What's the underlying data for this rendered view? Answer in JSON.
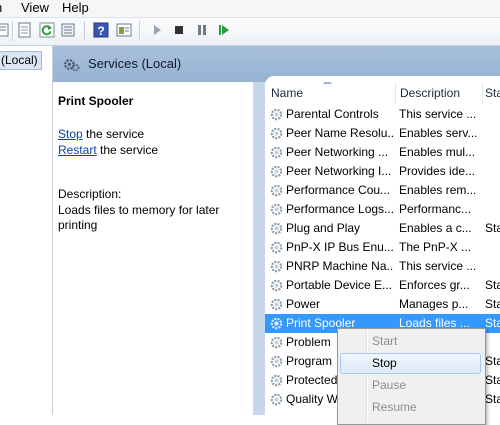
{
  "menu": {
    "items": [
      "n",
      "View",
      "Help"
    ]
  },
  "toolbar": {
    "icons": [
      "properties-icon",
      "export-list-icon",
      "refresh-icon",
      "list-icon",
      "help-icon",
      "show-hide-icon",
      "play-icon",
      "stop-icon",
      "pause-icon",
      "restart-icon"
    ]
  },
  "tree": {
    "selected_label": "(Local)"
  },
  "header": {
    "title": "Services (Local)"
  },
  "detail": {
    "service_name": "Print Spooler",
    "stop_link": "Stop",
    "stop_rest": " the service",
    "restart_link": "Restart",
    "restart_rest": " the service",
    "description_label": "Description:",
    "description_line1": "Loads files to memory for later",
    "description_line2": "printing"
  },
  "table": {
    "columns": {
      "name": "Name",
      "description": "Description",
      "status": "Sta"
    },
    "rows": [
      {
        "name": "Parental Controls",
        "description": "This service ...",
        "status": ""
      },
      {
        "name": "Peer Name Resolu...",
        "description": "Enables serv...",
        "status": ""
      },
      {
        "name": "Peer Networking ...",
        "description": "Enables mul...",
        "status": ""
      },
      {
        "name": "Peer Networking I...",
        "description": "Provides ide...",
        "status": ""
      },
      {
        "name": "Performance Cou...",
        "description": "Enables rem...",
        "status": ""
      },
      {
        "name": "Performance Logs...",
        "description": "Performanc...",
        "status": ""
      },
      {
        "name": "Plug and Play",
        "description": "Enables a c...",
        "status": "Sta"
      },
      {
        "name": "PnP-X IP Bus Enu...",
        "description": "The PnP-X ...",
        "status": ""
      },
      {
        "name": "PNRP Machine Na...",
        "description": "This service ...",
        "status": ""
      },
      {
        "name": "Portable Device E...",
        "description": "Enforces gr...",
        "status": "Sta"
      },
      {
        "name": "Power",
        "description": "Manages p...",
        "status": "Sta"
      },
      {
        "name": "Print Spooler",
        "description": "Loads files ...",
        "status": "Sta"
      },
      {
        "name": "Problem",
        "description": "",
        "status": ""
      },
      {
        "name": "Program",
        "description": "",
        "status": "Sta"
      },
      {
        "name": "Protected",
        "description": "",
        "status": "Sta"
      },
      {
        "name": "Quality W",
        "description": "",
        "status": "Sta"
      }
    ]
  },
  "context_menu": {
    "start": "Start",
    "stop": "Stop",
    "pause": "Pause",
    "resume": "Resume"
  },
  "colors": {
    "selection": "#3399ff",
    "header": "#a8c0dd",
    "link": "#0645ad"
  }
}
